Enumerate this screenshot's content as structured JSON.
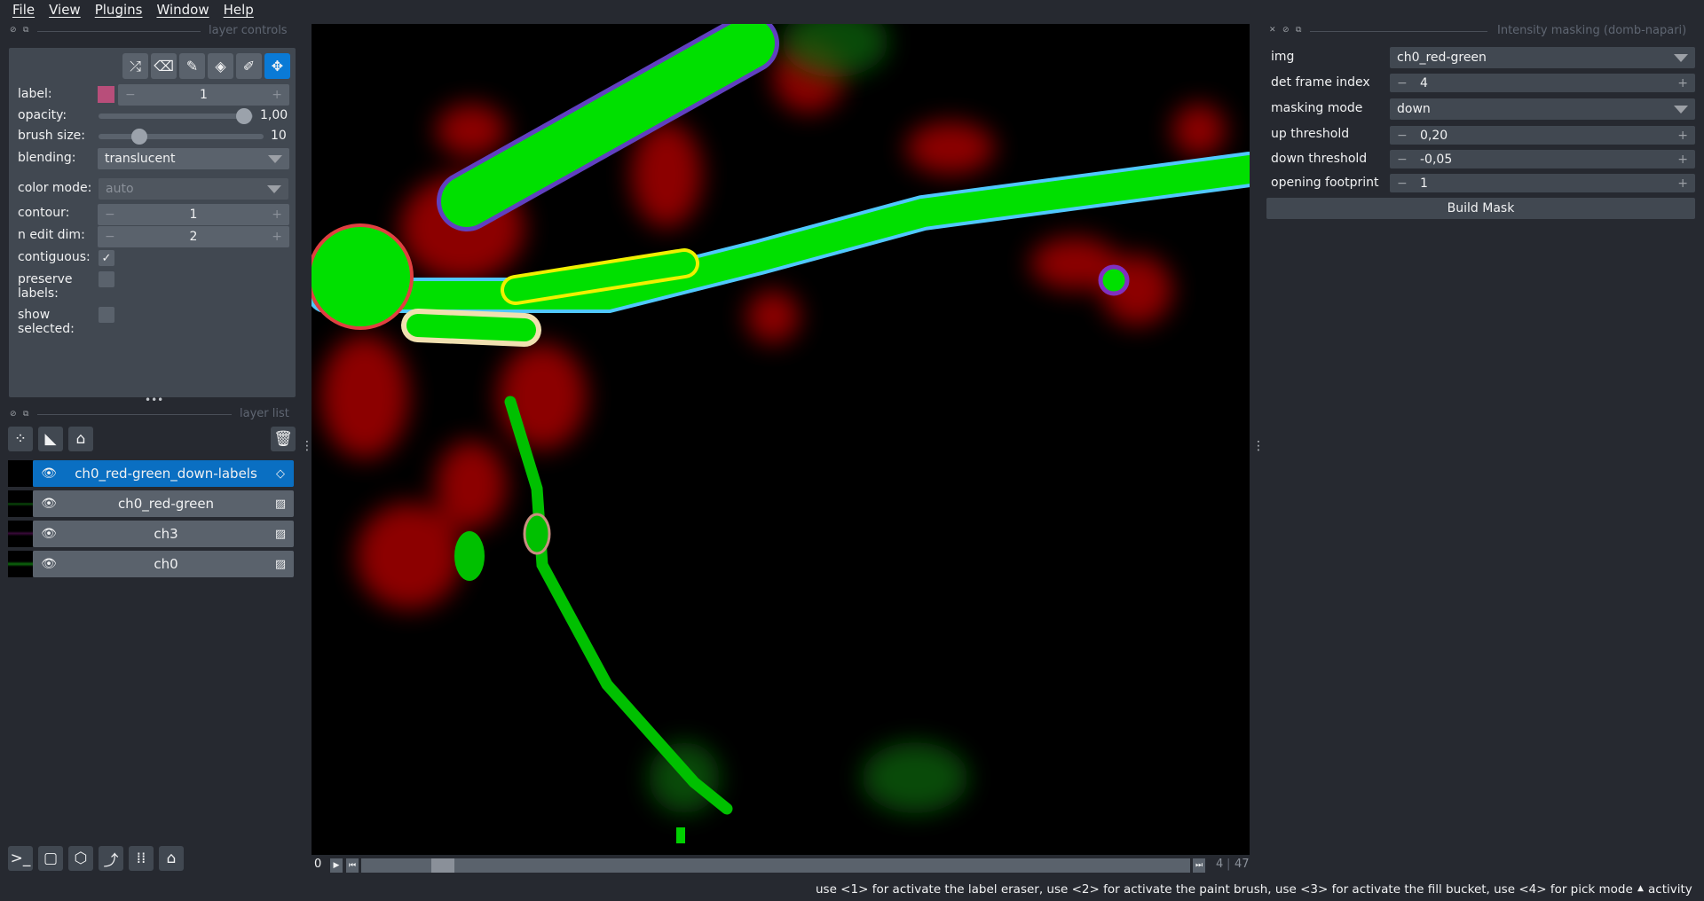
{
  "menu": [
    "File",
    "View",
    "Plugins",
    "Window",
    "Help"
  ],
  "layer_controls": {
    "title": "layer controls",
    "tools": [
      "shuffle-icon",
      "eraser-icon",
      "paint-brush-icon",
      "fill-bucket-icon",
      "picker-icon",
      "pan-zoom-icon"
    ],
    "label_label": "label:",
    "label_value": "1",
    "label_color": "#b84e7a",
    "opacity_label": "opacity:",
    "opacity_value": "1,00",
    "opacity_fraction": 1.0,
    "brush_label": "brush size:",
    "brush_value": "10",
    "brush_fraction": 0.2,
    "blending_label": "blending:",
    "blending_value": "translucent",
    "color_mode_label": "color mode:",
    "color_mode_value": "auto",
    "contour_label": "contour:",
    "contour_value": "1",
    "edit_dim_label": "n edit dim:",
    "edit_dim_value": "2",
    "contiguous_label": "contiguous:",
    "contiguous_checked": true,
    "preserve_label_1": "preserve",
    "preserve_label_2": "labels:",
    "show_label_1": "show",
    "show_label_2": "selected:"
  },
  "layer_list": {
    "title": "layer list",
    "layers": [
      {
        "name": "ch0_red-green_down-labels",
        "type": "labels",
        "selected": true
      },
      {
        "name": "ch0_red-green",
        "type": "image",
        "selected": false
      },
      {
        "name": "ch3",
        "type": "image",
        "selected": false
      },
      {
        "name": "ch0",
        "type": "image",
        "selected": false
      }
    ]
  },
  "dims": {
    "start": "0",
    "current": "4",
    "total": "47",
    "fraction": 0.087
  },
  "plugin": {
    "title": "Intensity masking (domb-napari)",
    "img_label": "img",
    "img_value": "ch0_red-green",
    "frame_label": "det frame index",
    "frame_value": "4",
    "mode_label": "masking mode",
    "mode_value": "down",
    "up_label": "up threshold",
    "up_value": "0,20",
    "down_label": "down threshold",
    "down_value": "-0,05",
    "footprint_label": "opening footprint",
    "footprint_value": "1",
    "build_label": "Build Mask"
  },
  "status": {
    "message": "use <1> for activate the label eraser, use <2> for activate the paint brush, use <3> for activate the fill bucket, use <4> for pick mode",
    "activity": "activity"
  }
}
